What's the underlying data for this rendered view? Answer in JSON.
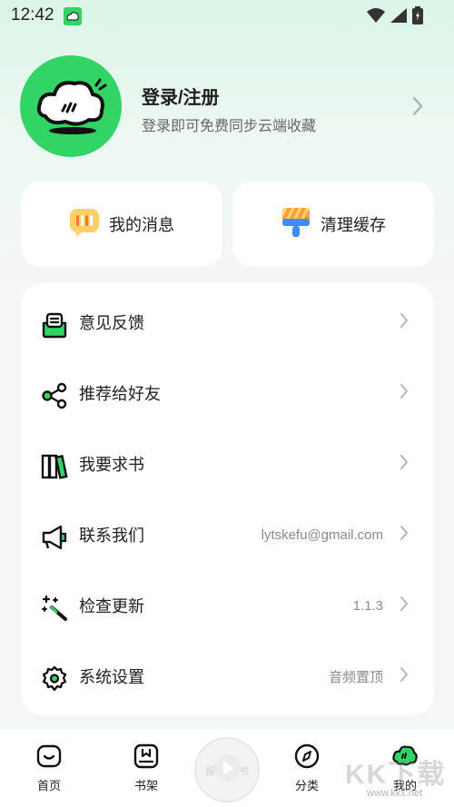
{
  "status_bar": {
    "time": "12:42"
  },
  "profile": {
    "title": "登录/注册",
    "subtitle": "登录即可免费同步云端收藏"
  },
  "quick_actions": [
    {
      "label": "我的消息",
      "icon": "message-icon"
    },
    {
      "label": "清理缓存",
      "icon": "brush-icon"
    }
  ],
  "menu": {
    "items": [
      {
        "label": "意见反馈",
        "value": "",
        "icon": "feedback-icon"
      },
      {
        "label": "推荐给好友",
        "value": "",
        "icon": "share-icon"
      },
      {
        "label": "我要求书",
        "value": "",
        "icon": "books-icon"
      },
      {
        "label": "联系我们",
        "value": "lytskefu@gmail.com",
        "icon": "megaphone-icon"
      },
      {
        "label": "检查更新",
        "value": "1.1.3",
        "icon": "magic-wand-icon"
      },
      {
        "label": "系统设置",
        "value": "音频置顶",
        "icon": "gear-icon"
      }
    ]
  },
  "bottom_nav": {
    "items": [
      {
        "label": "首页",
        "icon": "home-icon"
      },
      {
        "label": "书架",
        "icon": "bookshelf-icon"
      },
      {
        "label": "分类",
        "icon": "compass-icon"
      },
      {
        "label": "我的",
        "icon": "profile-cloud-icon"
      }
    ],
    "center_label_left": "留",
    "center_label_right": "书"
  },
  "watermark": {
    "text": "KK下载",
    "url": "www.kkx.net"
  },
  "colors": {
    "accent": "#33d466",
    "card": "#ffffff",
    "muted": "#8a8a8a"
  }
}
